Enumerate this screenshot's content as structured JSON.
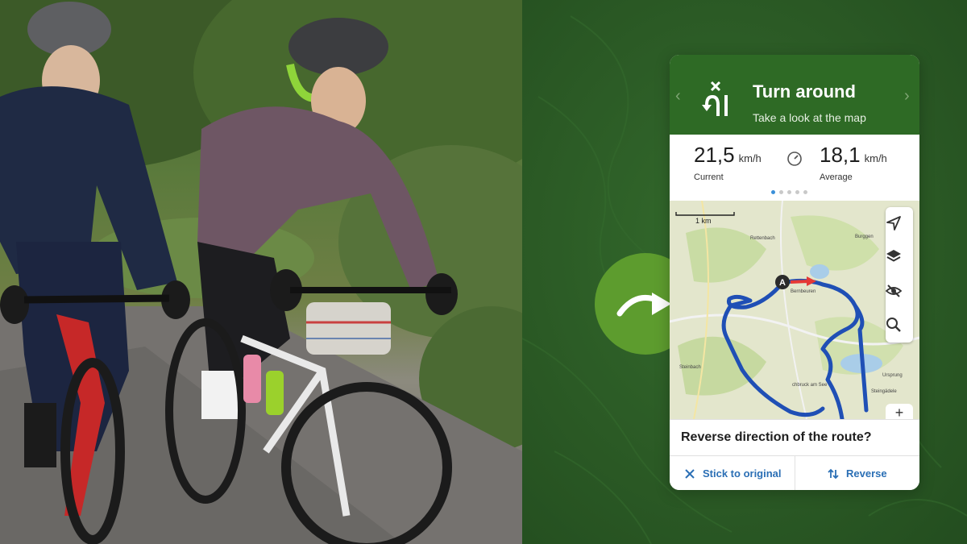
{
  "navigation": {
    "title": "Turn around",
    "subtitle": "Take a look at the map",
    "icon": "turn-around-icon"
  },
  "stats": {
    "current": {
      "value": "21,5",
      "unit": "km/h",
      "label": "Current"
    },
    "average": {
      "value": "18,1",
      "unit": "km/h",
      "label": "Average"
    },
    "speed_icon": "speedometer-icon",
    "page_dots": 5,
    "active_dot": 1
  },
  "map": {
    "scale_label": "1 km",
    "places": [
      "Rettenbach",
      "Burggen",
      "Bernbeuren",
      "Steinbach",
      "Ursprung",
      "chbruck am See",
      "Steingädele"
    ],
    "start_marker": "A",
    "tools": [
      "navigation-arrow-icon",
      "layers-icon",
      "hide-eye-icon",
      "search-icon"
    ],
    "zoom_in": "+"
  },
  "dialog": {
    "question": "Reverse direction of the route?",
    "cancel_label": "Stick to original",
    "confirm_label": "Reverse"
  },
  "colors": {
    "header_green": "#2e6a25",
    "panel_green": "#2b5a25",
    "badge_green": "#5d9c2e",
    "action_blue": "#2b6fb5",
    "route_blue": "#1f4fb5"
  }
}
